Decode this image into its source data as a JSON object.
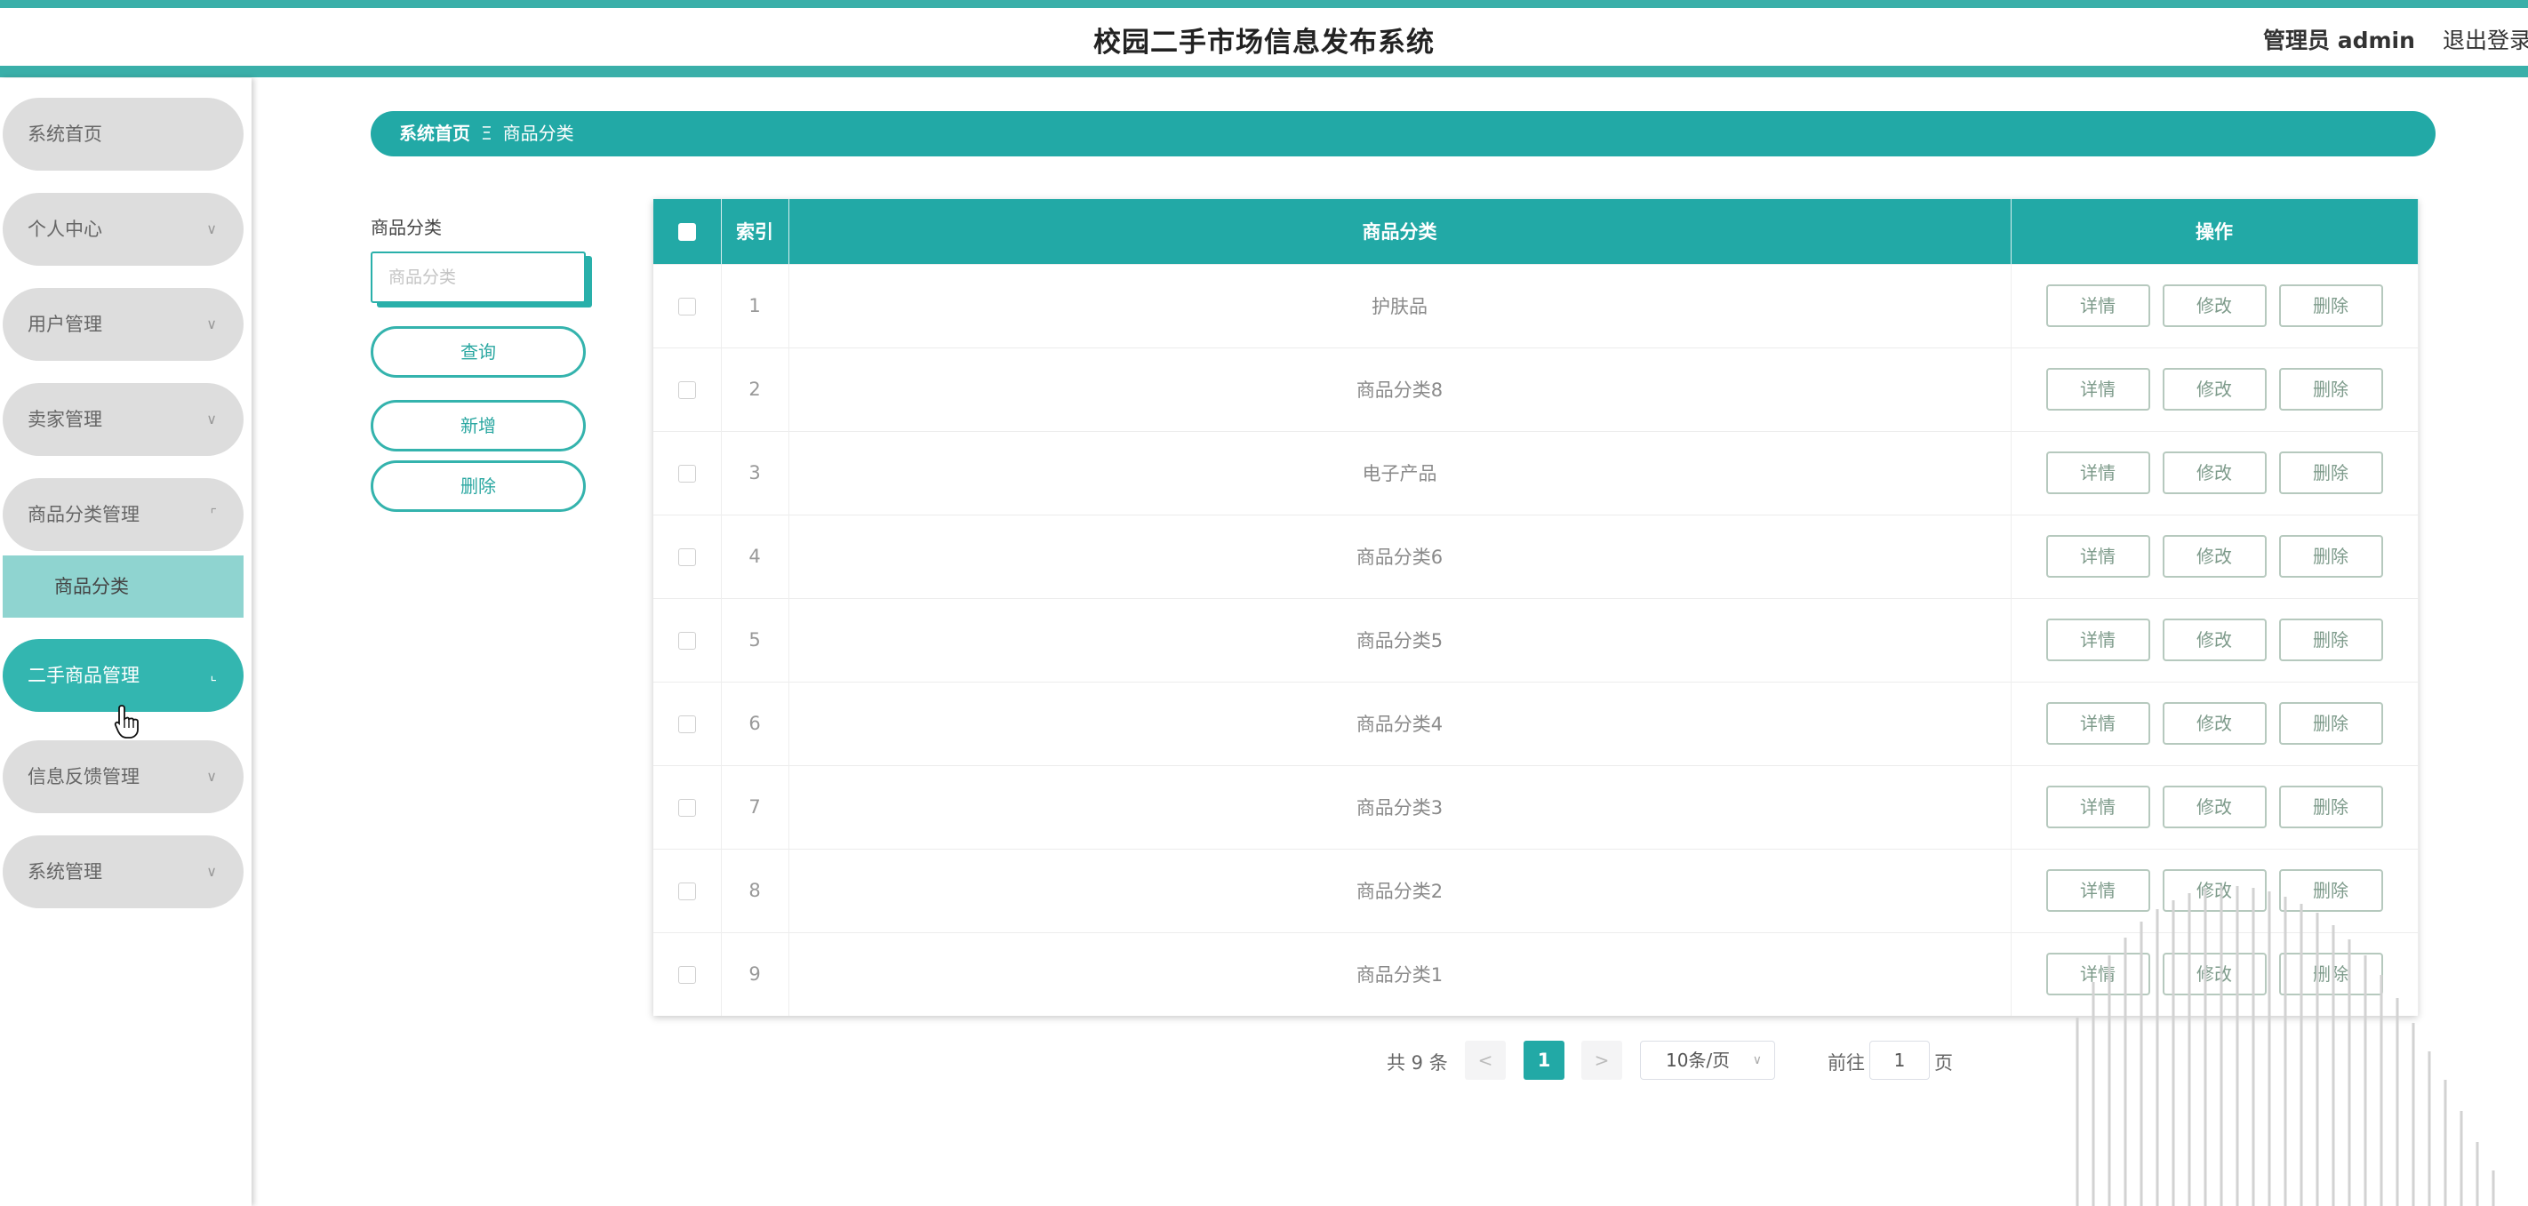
{
  "header": {
    "title": "校园二手市场信息发布系统",
    "user": "管理员 admin",
    "logout": "退出登录"
  },
  "sidebar": {
    "items": [
      {
        "label": "系统首页"
      },
      {
        "label": "个人中心"
      },
      {
        "label": "用户管理"
      },
      {
        "label": "卖家管理"
      },
      {
        "label": "商品分类管理"
      },
      {
        "label": "二手商品管理"
      },
      {
        "label": "信息反馈管理"
      },
      {
        "label": "系统管理"
      }
    ],
    "submenu": {
      "label": "商品分类"
    },
    "colors": {
      "menu_bg": "#dddddd",
      "active_bg": "#33b6b0",
      "submenu_bg": "#8fd4d0"
    }
  },
  "breadcrumb": {
    "home": "系统首页",
    "separator": "Ξ",
    "current": "商品分类"
  },
  "search": {
    "label": "商品分类",
    "placeholder": "商品分类",
    "query_label": "查询",
    "add_label": "新增",
    "delete_label": "删除"
  },
  "table": {
    "columns": {
      "index": "索引",
      "category": "商品分类",
      "actions": "操作"
    },
    "rows": [
      {
        "index": "1",
        "category": "护肤品"
      },
      {
        "index": "2",
        "category": "商品分类8"
      },
      {
        "index": "3",
        "category": "电子产品"
      },
      {
        "index": "4",
        "category": "商品分类6"
      },
      {
        "index": "5",
        "category": "商品分类5"
      },
      {
        "index": "6",
        "category": "商品分类4"
      },
      {
        "index": "7",
        "category": "商品分类3"
      },
      {
        "index": "8",
        "category": "商品分类2"
      },
      {
        "index": "9",
        "category": "商品分类1"
      }
    ],
    "actions": {
      "detail": "详情",
      "edit": "修改",
      "delete": "删除"
    }
  },
  "pagination": {
    "total": "共 9 条",
    "prev": "<",
    "current": "1",
    "next": ">",
    "page_size": "10条/页",
    "goto_label": "前往",
    "goto_value": "1",
    "goto_unit": "页"
  },
  "theme": {
    "accent": "#22a9a6"
  }
}
